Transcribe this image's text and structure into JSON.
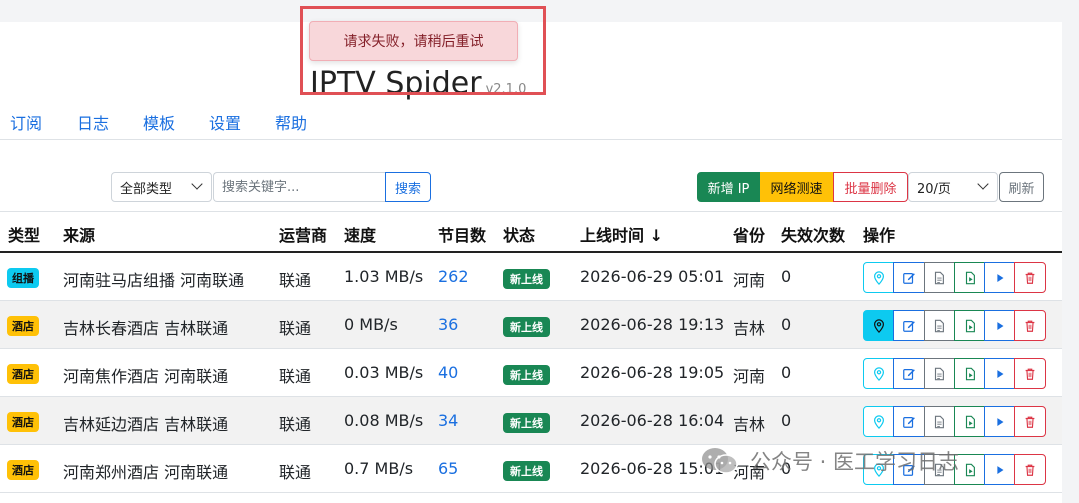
{
  "header": {
    "title": "IPTV Spider",
    "version": "v2.1.0"
  },
  "nav": {
    "items": [
      "订阅",
      "日志",
      "模板",
      "设置",
      "帮助"
    ]
  },
  "toolbar": {
    "type_filter": "全部类型",
    "search_placeholder": "搜索关键字...",
    "search_label": "搜索",
    "add_label": "新增 IP",
    "speed_label": "网络测速",
    "batch_delete_label": "批量删除",
    "page_size": "20/页",
    "refresh_label": "刷新"
  },
  "table": {
    "columns": [
      "类型",
      "来源",
      "运营商",
      "速度",
      "节目数",
      "状态",
      "上线时间 ↓",
      "省份",
      "失效次数",
      "操作"
    ],
    "rows": [
      {
        "type": "组播",
        "source": "河南驻马店组播 河南联通",
        "isp": "联通",
        "speed": "1.03 MB/s",
        "programs": "262",
        "status": "新上线",
        "online": "2026-06-29 05:01",
        "province": "河南",
        "failures": "0"
      },
      {
        "type": "酒店",
        "source": "吉林长春酒店 吉林联通",
        "isp": "联通",
        "speed": "0 MB/s",
        "programs": "36",
        "status": "新上线",
        "online": "2026-06-28 19:13",
        "province": "吉林",
        "failures": "0"
      },
      {
        "type": "酒店",
        "source": "河南焦作酒店 河南联通",
        "isp": "联通",
        "speed": "0.03 MB/s",
        "programs": "40",
        "status": "新上线",
        "online": "2026-06-28 19:05",
        "province": "河南",
        "failures": "0"
      },
      {
        "type": "酒店",
        "source": "吉林延边酒店 吉林联通",
        "isp": "联通",
        "speed": "0.08 MB/s",
        "programs": "34",
        "status": "新上线",
        "online": "2026-06-28 16:04",
        "province": "吉林",
        "failures": "0"
      },
      {
        "type": "酒店",
        "source": "河南郑州酒店 河南联通",
        "isp": "联通",
        "speed": "0.7 MB/s",
        "programs": "65",
        "status": "新上线",
        "online": "2026-06-28 15:01",
        "province": "河南",
        "failures": "0"
      }
    ]
  },
  "toast": {
    "message": "请求失败，请稍后重试"
  },
  "watermark": {
    "text": "公众号 · 医工学习日志"
  },
  "colors": {
    "primary": "#1a6fe0",
    "success": "#198754",
    "warning": "#ffc107",
    "danger": "#dc3545",
    "info": "#0dcaf0",
    "badge_multicast": "#0dcaf0",
    "badge_hotel": "#ffc107"
  },
  "icons": [
    "chevron-down-icon",
    "location-pin-icon",
    "edit-icon",
    "document-icon",
    "file-play-icon",
    "play-icon",
    "trash-icon",
    "wechat-icon"
  ]
}
